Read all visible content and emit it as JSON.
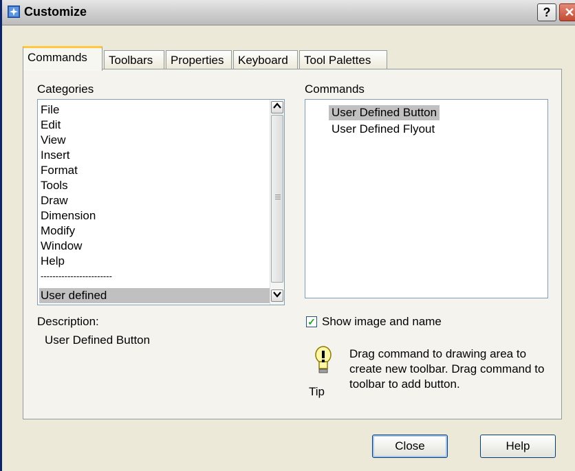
{
  "window": {
    "title": "Customize",
    "help_label": "?",
    "close_label": "✕"
  },
  "tabs": [
    {
      "label": "Commands"
    },
    {
      "label": "Toolbars"
    },
    {
      "label": "Properties"
    },
    {
      "label": "Keyboard"
    },
    {
      "label": "Tool Palettes"
    }
  ],
  "categories": {
    "label": "Categories",
    "items": [
      "File",
      "Edit",
      "View",
      "Insert",
      "Format",
      "Tools",
      "Draw",
      "Dimension",
      "Modify",
      "Window",
      "Help",
      "------------------------",
      "User defined"
    ],
    "selected": "User defined"
  },
  "commands": {
    "label": "Commands",
    "items": [
      "User Defined Button",
      "User Defined Flyout"
    ],
    "selected": "User Defined Button"
  },
  "description": {
    "label": "Description:",
    "value": "User Defined Button"
  },
  "show_image": {
    "label": "Show image and name",
    "checked": true
  },
  "tip": {
    "label": "Tip",
    "text_lines": [
      "Drag command to drawing area to",
      "create new toolbar. Drag command to",
      "toolbar to add button."
    ]
  },
  "buttons": {
    "close": "Close",
    "help": "Help"
  },
  "icons": {
    "app": "customize-app-icon",
    "tip": "lightbulb-icon",
    "scroll_up": "arrow-up-icon",
    "scroll_down": "arrow-down-icon",
    "check": "checkmark-icon"
  },
  "colors": {
    "selection": "#c0c0c0",
    "tab_accent": "#ffc83c",
    "dialog_bg": "#ece9d8"
  }
}
